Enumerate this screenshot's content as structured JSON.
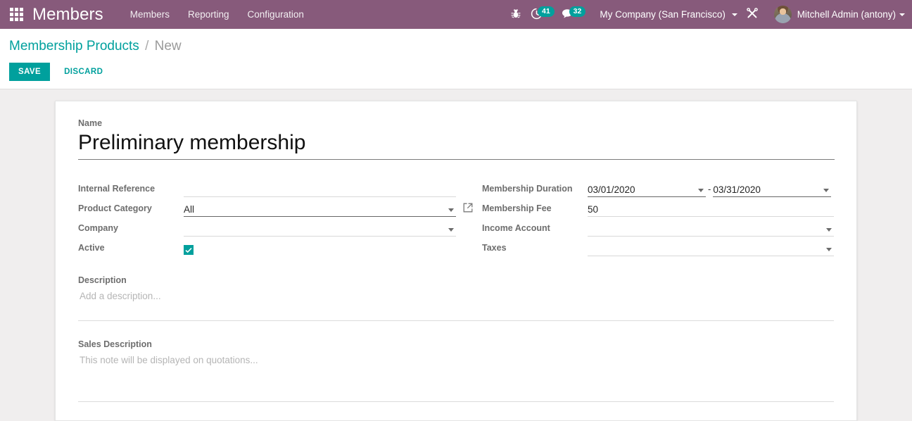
{
  "navbar": {
    "apps_icon": "apps-grid-icon",
    "brand": "Members",
    "menu": [
      {
        "label": "Members"
      },
      {
        "label": "Reporting"
      },
      {
        "label": "Configuration"
      }
    ],
    "debug_icon": "bug-icon",
    "activities": {
      "icon": "clock-icon",
      "count": "41"
    },
    "messages": {
      "icon": "chat-bubble-icon",
      "count": "32"
    },
    "company": "My Company (San Francisco)",
    "tools_icon": "tools-icon",
    "user": "Mitchell Admin (antony)",
    "accent_color": "#875A7B",
    "badge_color": "#00A09D"
  },
  "control_panel": {
    "breadcrumb_root": "Membership Products",
    "breadcrumb_sep": "/",
    "breadcrumb_current": "New",
    "save_label": "SAVE",
    "discard_label": "DISCARD",
    "primary_color": "#00A09D"
  },
  "form": {
    "name": {
      "label": "Name",
      "value": "Preliminary membership"
    },
    "left": {
      "internal_reference": {
        "label": "Internal Reference",
        "value": ""
      },
      "product_category": {
        "label": "Product Category",
        "value": "All",
        "external_link_icon": "external-link-icon"
      },
      "company": {
        "label": "Company",
        "value": ""
      },
      "active": {
        "label": "Active",
        "checked": true
      }
    },
    "right": {
      "membership_duration": {
        "label": "Membership Duration",
        "date_from": "03/01/2020",
        "separator": "-",
        "date_to": "03/31/2020"
      },
      "membership_fee": {
        "label": "Membership Fee",
        "value": "50"
      },
      "income_account": {
        "label": "Income Account",
        "value": ""
      },
      "taxes": {
        "label": "Taxes",
        "value": ""
      }
    },
    "description": {
      "label": "Description",
      "placeholder": "Add a description..."
    },
    "sales_description": {
      "label": "Sales Description",
      "placeholder": "This note will be displayed on quotations..."
    }
  }
}
